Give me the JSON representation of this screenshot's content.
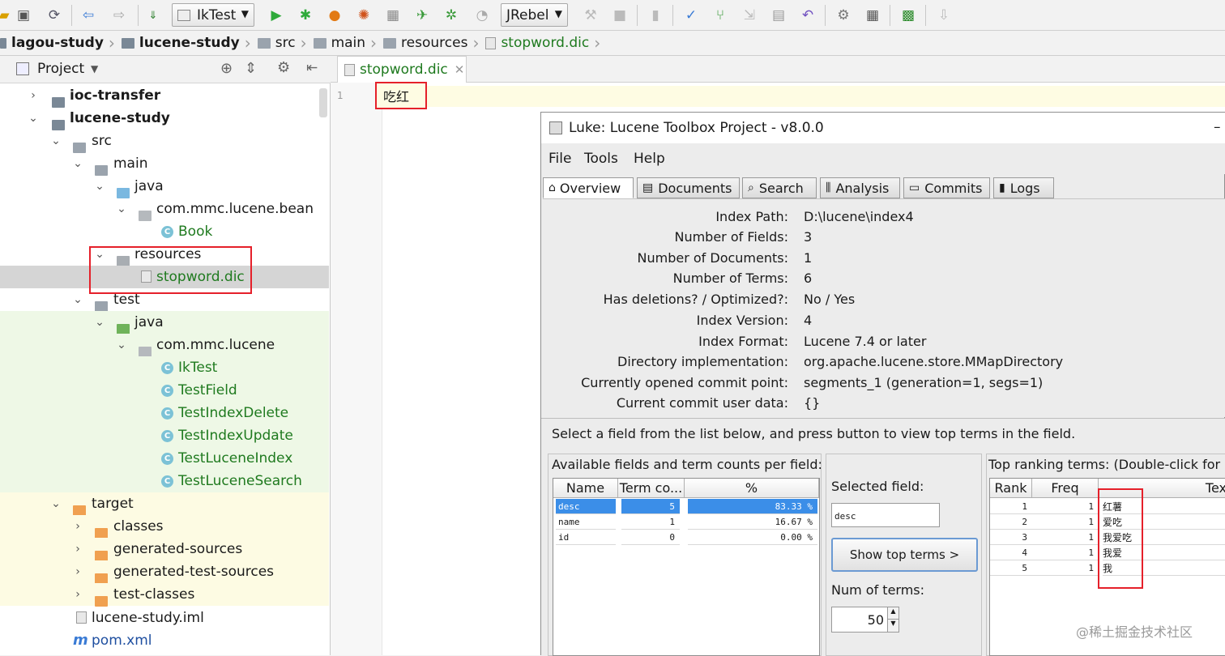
{
  "toolbar": {
    "run_config": "IkTest",
    "jrebel": "JRebel"
  },
  "breadcrumb": [
    "lagou-study",
    "lucene-study",
    "src",
    "main",
    "resources",
    "stopword.dic"
  ],
  "project_panel": {
    "title": "Project",
    "tree": [
      {
        "label": "ioc-transfer",
        "bold": true
      },
      {
        "label": "lucene-study",
        "bold": true
      },
      {
        "label": "src"
      },
      {
        "label": "main"
      },
      {
        "label": "java"
      },
      {
        "label": "com.mmc.lucene.bean"
      },
      {
        "label": "Book"
      },
      {
        "label": "resources"
      },
      {
        "label": "stopword.dic"
      },
      {
        "label": "test"
      },
      {
        "label": "java"
      },
      {
        "label": "com.mmc.lucene"
      },
      {
        "label": "IkTest"
      },
      {
        "label": "TestField"
      },
      {
        "label": "TestIndexDelete"
      },
      {
        "label": "TestIndexUpdate"
      },
      {
        "label": "TestLuceneIndex"
      },
      {
        "label": "TestLuceneSearch"
      },
      {
        "label": "target"
      },
      {
        "label": "classes"
      },
      {
        "label": "generated-sources"
      },
      {
        "label": "generated-test-sources"
      },
      {
        "label": "test-classes"
      },
      {
        "label": "lucene-study.iml"
      },
      {
        "label": "pom.xml"
      }
    ]
  },
  "editor": {
    "tab": "stopword.dic",
    "line_number": "1",
    "line1_text": "吃红"
  },
  "luke": {
    "title": "Luke: Lucene Toolbox Project - v8.0.0",
    "menu": [
      "File",
      "Tools",
      "Help"
    ],
    "tabs": [
      "Overview",
      "Documents",
      "Search",
      "Analysis",
      "Commits",
      "Logs"
    ],
    "overview": [
      {
        "key": "Index Path:",
        "value": "D:\\lucene\\index4"
      },
      {
        "key": "Number of Fields:",
        "value": "3"
      },
      {
        "key": "Number of Documents:",
        "value": "1"
      },
      {
        "key": "Number of Terms:",
        "value": "6"
      },
      {
        "key": "Has deletions? / Optimized?:",
        "value": "No / Yes"
      },
      {
        "key": "Index Version:",
        "value": "4"
      },
      {
        "key": "Index Format:",
        "value": "Lucene 7.4 or later"
      },
      {
        "key": "Directory implementation:",
        "value": "org.apache.lucene.store.MMapDirectory"
      },
      {
        "key": "Currently opened commit point:",
        "value": "segments_1 (generation=1, segs=1)"
      },
      {
        "key": "Current commit user data:",
        "value": "{}"
      }
    ],
    "instruction": "Select a field from the list below, and press button to view top terms in the field.",
    "fields_title": "Available fields and term counts per field:",
    "fields_headers": [
      "Name",
      "Term co...",
      "%"
    ],
    "fields": [
      {
        "name": "desc",
        "count": "5",
        "pct": "83.33 %"
      },
      {
        "name": "name",
        "count": "1",
        "pct": "16.67 %"
      },
      {
        "name": "id",
        "count": "0",
        "pct": "0.00 %"
      }
    ],
    "selected_field_label": "Selected field:",
    "selected_field_value": "desc",
    "show_top_terms": "Show top terms >",
    "num_terms_label": "Num of terms:",
    "num_terms_value": "50",
    "top_title": "Top ranking terms: (Double-click for m",
    "top_headers": [
      "Rank",
      "Freq",
      "Tex"
    ],
    "top_terms": [
      {
        "rank": "1",
        "freq": "1",
        "text": "红薯"
      },
      {
        "rank": "2",
        "freq": "1",
        "text": "爱吃"
      },
      {
        "rank": "3",
        "freq": "1",
        "text": "我爱吃"
      },
      {
        "rank": "4",
        "freq": "1",
        "text": "我爱"
      },
      {
        "rank": "5",
        "freq": "1",
        "text": "我"
      }
    ]
  },
  "watermark": "@稀土掘金技术社区"
}
